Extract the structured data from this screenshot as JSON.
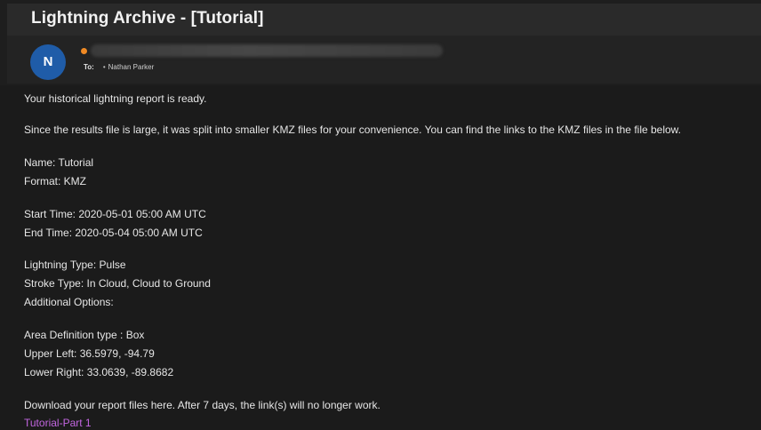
{
  "email": {
    "subject": "Lightning Archive - [Tutorial]",
    "avatar_initial": "N",
    "to_label": "To:",
    "recipient": "Nathan Parker",
    "body": {
      "intro": "Your historical lightning report is ready.",
      "split_note": "Since the results file is large, it was split into smaller KMZ files for your convenience. You can find the links to the KMZ files in the file below.",
      "name": "Name: Tutorial",
      "format": "Format: KMZ",
      "start_time": "Start Time: 2020-05-01 05:00 AM UTC",
      "end_time": "End Time: 2020-05-04 05:00 AM UTC",
      "lightning_type": "Lightning Type: Pulse",
      "stroke_type": "Stroke Type: In Cloud, Cloud to Ground",
      "additional_options": "Additional Options:",
      "area_definition": "Area Definition type : Box",
      "upper_left": "Upper Left: 36.5979, -94.79",
      "lower_right": "Lower Right: 33.0639, -89.8682",
      "download_note": "Download your report files here. After 7 days, the link(s) will no longer work.",
      "file_link": "Tutorial-Part 1"
    }
  },
  "colors": {
    "background": "#1b1b1b",
    "avatar": "#1f5ca8",
    "unread_dot": "#f08a24",
    "link": "#c266e0"
  }
}
